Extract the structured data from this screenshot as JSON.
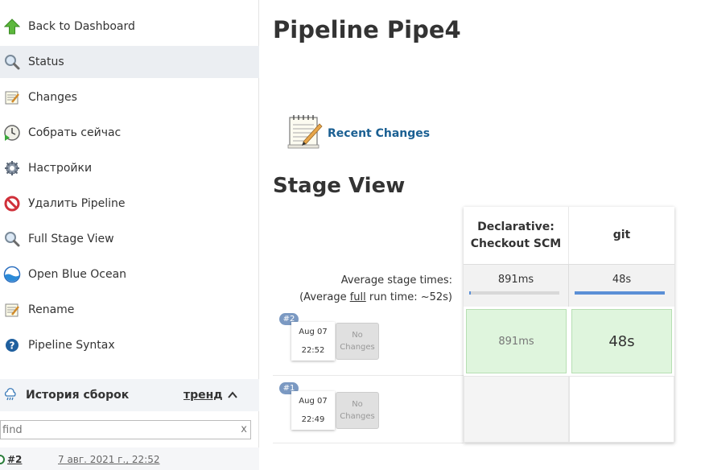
{
  "sidebar": {
    "items": [
      {
        "label": "Back to Dashboard",
        "icon": "green-up-arrow-icon"
      },
      {
        "label": "Status",
        "icon": "magnifier-icon"
      },
      {
        "label": "Changes",
        "icon": "notepad-icon"
      },
      {
        "label": "Собрать сейчас",
        "icon": "clock-play-icon"
      },
      {
        "label": "Настройки",
        "icon": "gear-icon"
      },
      {
        "label": "Удалить Pipeline",
        "icon": "no-entry-icon"
      },
      {
        "label": "Full Stage View",
        "icon": "magnifier-icon"
      },
      {
        "label": "Open Blue Ocean",
        "icon": "blue-ocean-icon"
      },
      {
        "label": "Rename",
        "icon": "notepad-icon"
      },
      {
        "label": "Pipeline Syntax",
        "icon": "help-icon"
      }
    ],
    "history": {
      "title": "История сборок",
      "trend": "тренд",
      "find_placeholder": "find",
      "find_clear": "x",
      "builds": [
        {
          "number": "#2",
          "date": "7 авг. 2021 г., 22:52"
        }
      ]
    }
  },
  "main": {
    "title": "Pipeline Pipe4",
    "recent_changes": "Recent Changes",
    "stage_view_title": "Stage View",
    "avg_stage_times_label": "Average stage times:",
    "avg_run_prefix": "(Average ",
    "avg_run_link": "full",
    "avg_run_suffix": " run time: ~52s)",
    "stages": [
      {
        "name_line1": "Declarative:",
        "name_line2": "Checkout SCM",
        "avg": "891ms",
        "avg_fraction": 0.02
      },
      {
        "name_line1": "git",
        "name_line2": "",
        "avg": "48s",
        "avg_fraction": 1.0
      }
    ],
    "runs": [
      {
        "badge": "#2",
        "date": "Aug 07",
        "time": "22:52",
        "changes_line1": "No",
        "changes_line2": "Changes",
        "cells": [
          "891ms",
          "48s"
        ]
      },
      {
        "badge": "#1",
        "date": "Aug 07",
        "time": "22:49",
        "changes_line1": "No",
        "changes_line2": "Changes",
        "cells": [
          "",
          ""
        ]
      }
    ]
  },
  "colors": {
    "accent_link": "#1a5f92",
    "success_cell": "#dff5dd",
    "badge": "#7b99c2",
    "avg_bar": "#5b8fd6"
  }
}
